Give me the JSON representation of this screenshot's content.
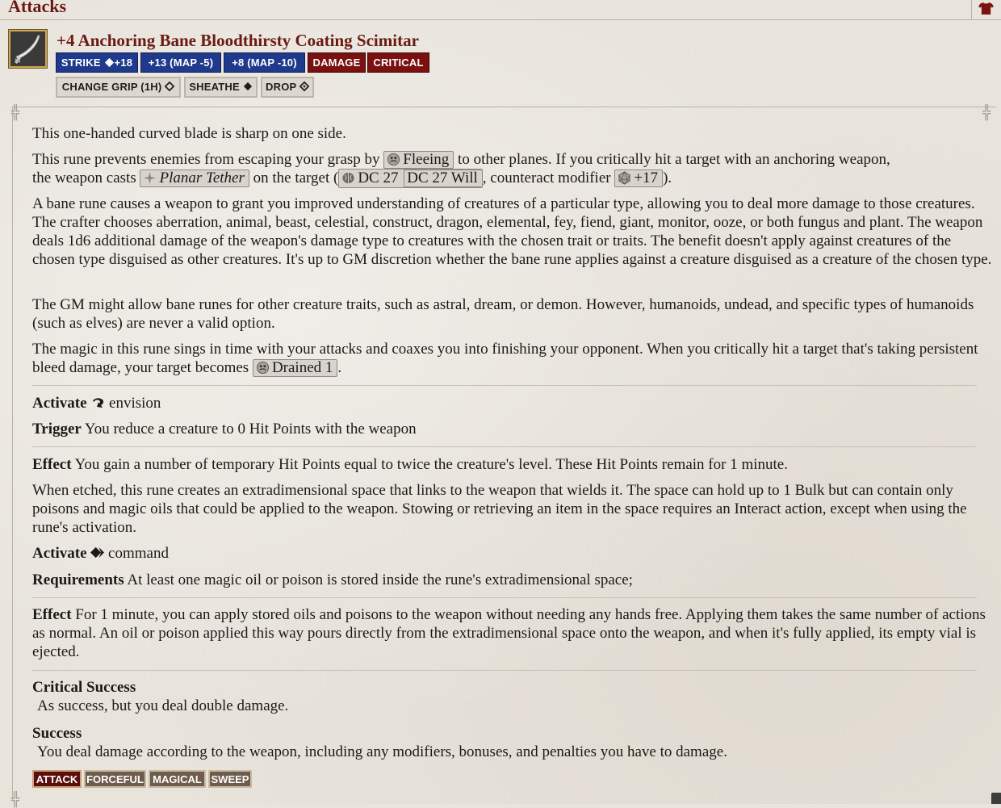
{
  "header": {
    "title": "Attacks",
    "icon": "shirt-icon"
  },
  "item": {
    "name": "+4 Anchoring Bane Bloodthirsty Coating Scimitar",
    "image": "scimitar-icon",
    "strike": {
      "label": "STRIKE",
      "bonus": "+18",
      "map1": "+13 (MAP -5)",
      "map2": "+8 (MAP -10)",
      "damage": "DAMAGE",
      "critical": "CRITICAL"
    },
    "actions": {
      "change_grip": "CHANGE GRIP (1H)",
      "sheathe": "SHEATHE",
      "drop": "DROP"
    }
  },
  "description": {
    "p1": "This one-handed curved blade is sharp on one side.",
    "p2": {
      "a": "This rune prevents enemies from escaping your grasp by",
      "fleeing": "Fleeing",
      "b": "to other planes. If you critically hit a target with an anchoring weapon,",
      "c": "the weapon casts",
      "planar": "Planar Tether",
      "d": "on the target (",
      "dc_a": "DC 27",
      "dc_b": "DC 27 Will",
      "e": ", counteract modifier",
      "mod": "+17",
      "f": ")."
    },
    "p3": "A bane rune causes a weapon to grant you improved understanding of creatures of a particular type, allowing you to deal more damage to those creatures. The crafter chooses aberration, animal, beast, celestial, construct, dragon, elemental, fey, fiend, giant, monitor, ooze, or both fungus and plant. The weapon deals 1d6 additional damage of the weapon's damage type to creatures with the chosen trait or traits. The benefit doesn't apply against creatures of the chosen type disguised as other creatures. It's up to GM discretion whether the bane rune applies against a creature disguised as a creature of the chosen type.",
    "p4": "The GM might allow bane runes for other creature traits, such as astral, dream, or demon. However, humanoids, undead, and specific types of humanoids (such as elves) are never a valid option.",
    "p5": {
      "a": "The magic in this rune sings in time with your attacks and coaxes you into finishing your opponent. When you critically hit a target that's taking persistent bleed damage, your target becomes",
      "drained": "Drained 1",
      "b": "."
    },
    "activate1": {
      "label": "Activate",
      "text": "envision"
    },
    "trigger": {
      "label": "Trigger",
      "text": "You reduce a creature to 0 Hit Points with the weapon"
    },
    "effect1": {
      "label": "Effect",
      "text": "You gain a number of temporary Hit Points equal to twice the creature's level. These Hit Points remain for 1 minute."
    },
    "p6": "When etched, this rune creates an extradimensional space that links to the weapon that wields it. The space can hold up to 1 Bulk but can contain only poisons and magic oils that could be applied to the weapon. Stowing or retrieving an item in the space requires an Interact action, except when using the rune's activation.",
    "activate2": {
      "label": "Activate",
      "text": "command"
    },
    "requirements": {
      "label": "Requirements",
      "text": "At least one magic oil or poison is stored inside the rune's extradimensional space;"
    },
    "effect2": {
      "label": "Effect",
      "text": "For 1 minute, you can apply stored oils and poisons to the weapon without needing any hands free. Applying them takes the same number of actions as normal. An oil or poison applied this way pours directly from the extradimensional space onto the weapon, and when it's fully applied, its empty vial is ejected."
    },
    "crit_success": {
      "label": "Critical Success",
      "text": "As success, but you deal double damage."
    },
    "success": {
      "label": "Success",
      "text": "You deal damage according to the weapon, including any modifiers, bonuses, and penalties you have to damage."
    }
  },
  "traits": [
    "ATTACK",
    "FORCEFUL",
    "MAGICAL",
    "SWEEP"
  ],
  "colors": {
    "title_red": "#6b1a12",
    "strike_blue": "#1f3a8c",
    "damage_red": "#7a1010",
    "trait_brown": "#6e5d4d"
  }
}
